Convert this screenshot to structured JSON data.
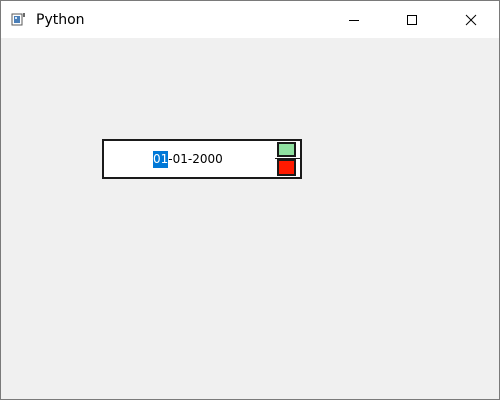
{
  "window": {
    "title": "Python",
    "icon": "python-app-icon"
  },
  "titlebar_buttons": {
    "minimize_icon": "minimize-icon",
    "maximize_icon": "maximize-icon",
    "close_icon": "close-icon"
  },
  "date_edit": {
    "selected_segment": "01",
    "rest": "-01-2000",
    "selection_color": "#0078d7",
    "spin_up_color": "#8fe0a0",
    "spin_down_color": "#ff1a00"
  }
}
